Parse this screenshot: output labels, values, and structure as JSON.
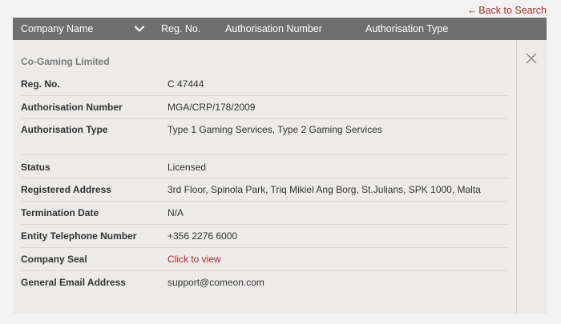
{
  "nav": {
    "back_arrow": "←",
    "back_label": "Back to Search"
  },
  "table_header": {
    "columns": [
      "Company Name",
      "Reg. No.",
      "Authorisation Number",
      "Authorisation Type"
    ]
  },
  "detail": {
    "company_name": "Co-Gaming Limited",
    "rows": [
      {
        "label": "Reg. No.",
        "value": "C 47444"
      },
      {
        "label": "Authorisation Number",
        "value": "MGA/CRP/178/2009"
      },
      {
        "label": "Authorisation Type",
        "value": "Type 1 Gaming Services, Type 2 Gaming Services"
      },
      {
        "label": "Status",
        "value": "Licensed"
      },
      {
        "label": "Registered Address",
        "value": "3rd Floor, Spinola Park, Triq Mikiel Ang Borg, St.Julians, SPK 1000, Malta"
      },
      {
        "label": "Termination Date",
        "value": "N/A"
      },
      {
        "label": "Entity Telephone Number",
        "value": "+356 2276 6000"
      },
      {
        "label": "Company Seal",
        "value": "Click to view"
      },
      {
        "label": "General Email Address",
        "value": "support@comeon.com"
      }
    ]
  },
  "colors": {
    "accent": "#b12a2a",
    "header_bg": "#6f6f6f",
    "panel_bg": "#ecebe9"
  }
}
